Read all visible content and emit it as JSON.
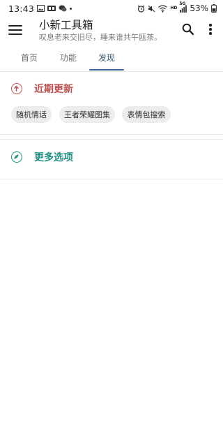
{
  "status_bar": {
    "time": "13:43",
    "left_icons": [
      "image-icon",
      "app-icon",
      "notification-dot"
    ],
    "right_icons": [
      "alarm-icon",
      "mute-icon",
      "wifi-icon",
      "hd-icon",
      "signal-icon"
    ],
    "network_label": "5G",
    "hd_label": "HD",
    "battery": "53%"
  },
  "app_bar": {
    "title": "小新工具箱",
    "subtitle": "叹息老来交旧尽，睡来谁共午瓯茶。"
  },
  "tabs": [
    {
      "label": "首页",
      "active": false
    },
    {
      "label": "功能",
      "active": false
    },
    {
      "label": "发现",
      "active": true
    }
  ],
  "sections": {
    "recent": {
      "title": "近期更新",
      "icon": "arrow-up-circle-icon",
      "color": "#c0504d",
      "chips": [
        "随机情话",
        "王者荣耀图集",
        "表情包搜索"
      ]
    },
    "more": {
      "title": "更多选项",
      "icon": "compass-icon",
      "color": "#1f8f84"
    }
  },
  "colors": {
    "tab_indicator": "#3b6a9a",
    "chip_bg": "#ececec"
  }
}
